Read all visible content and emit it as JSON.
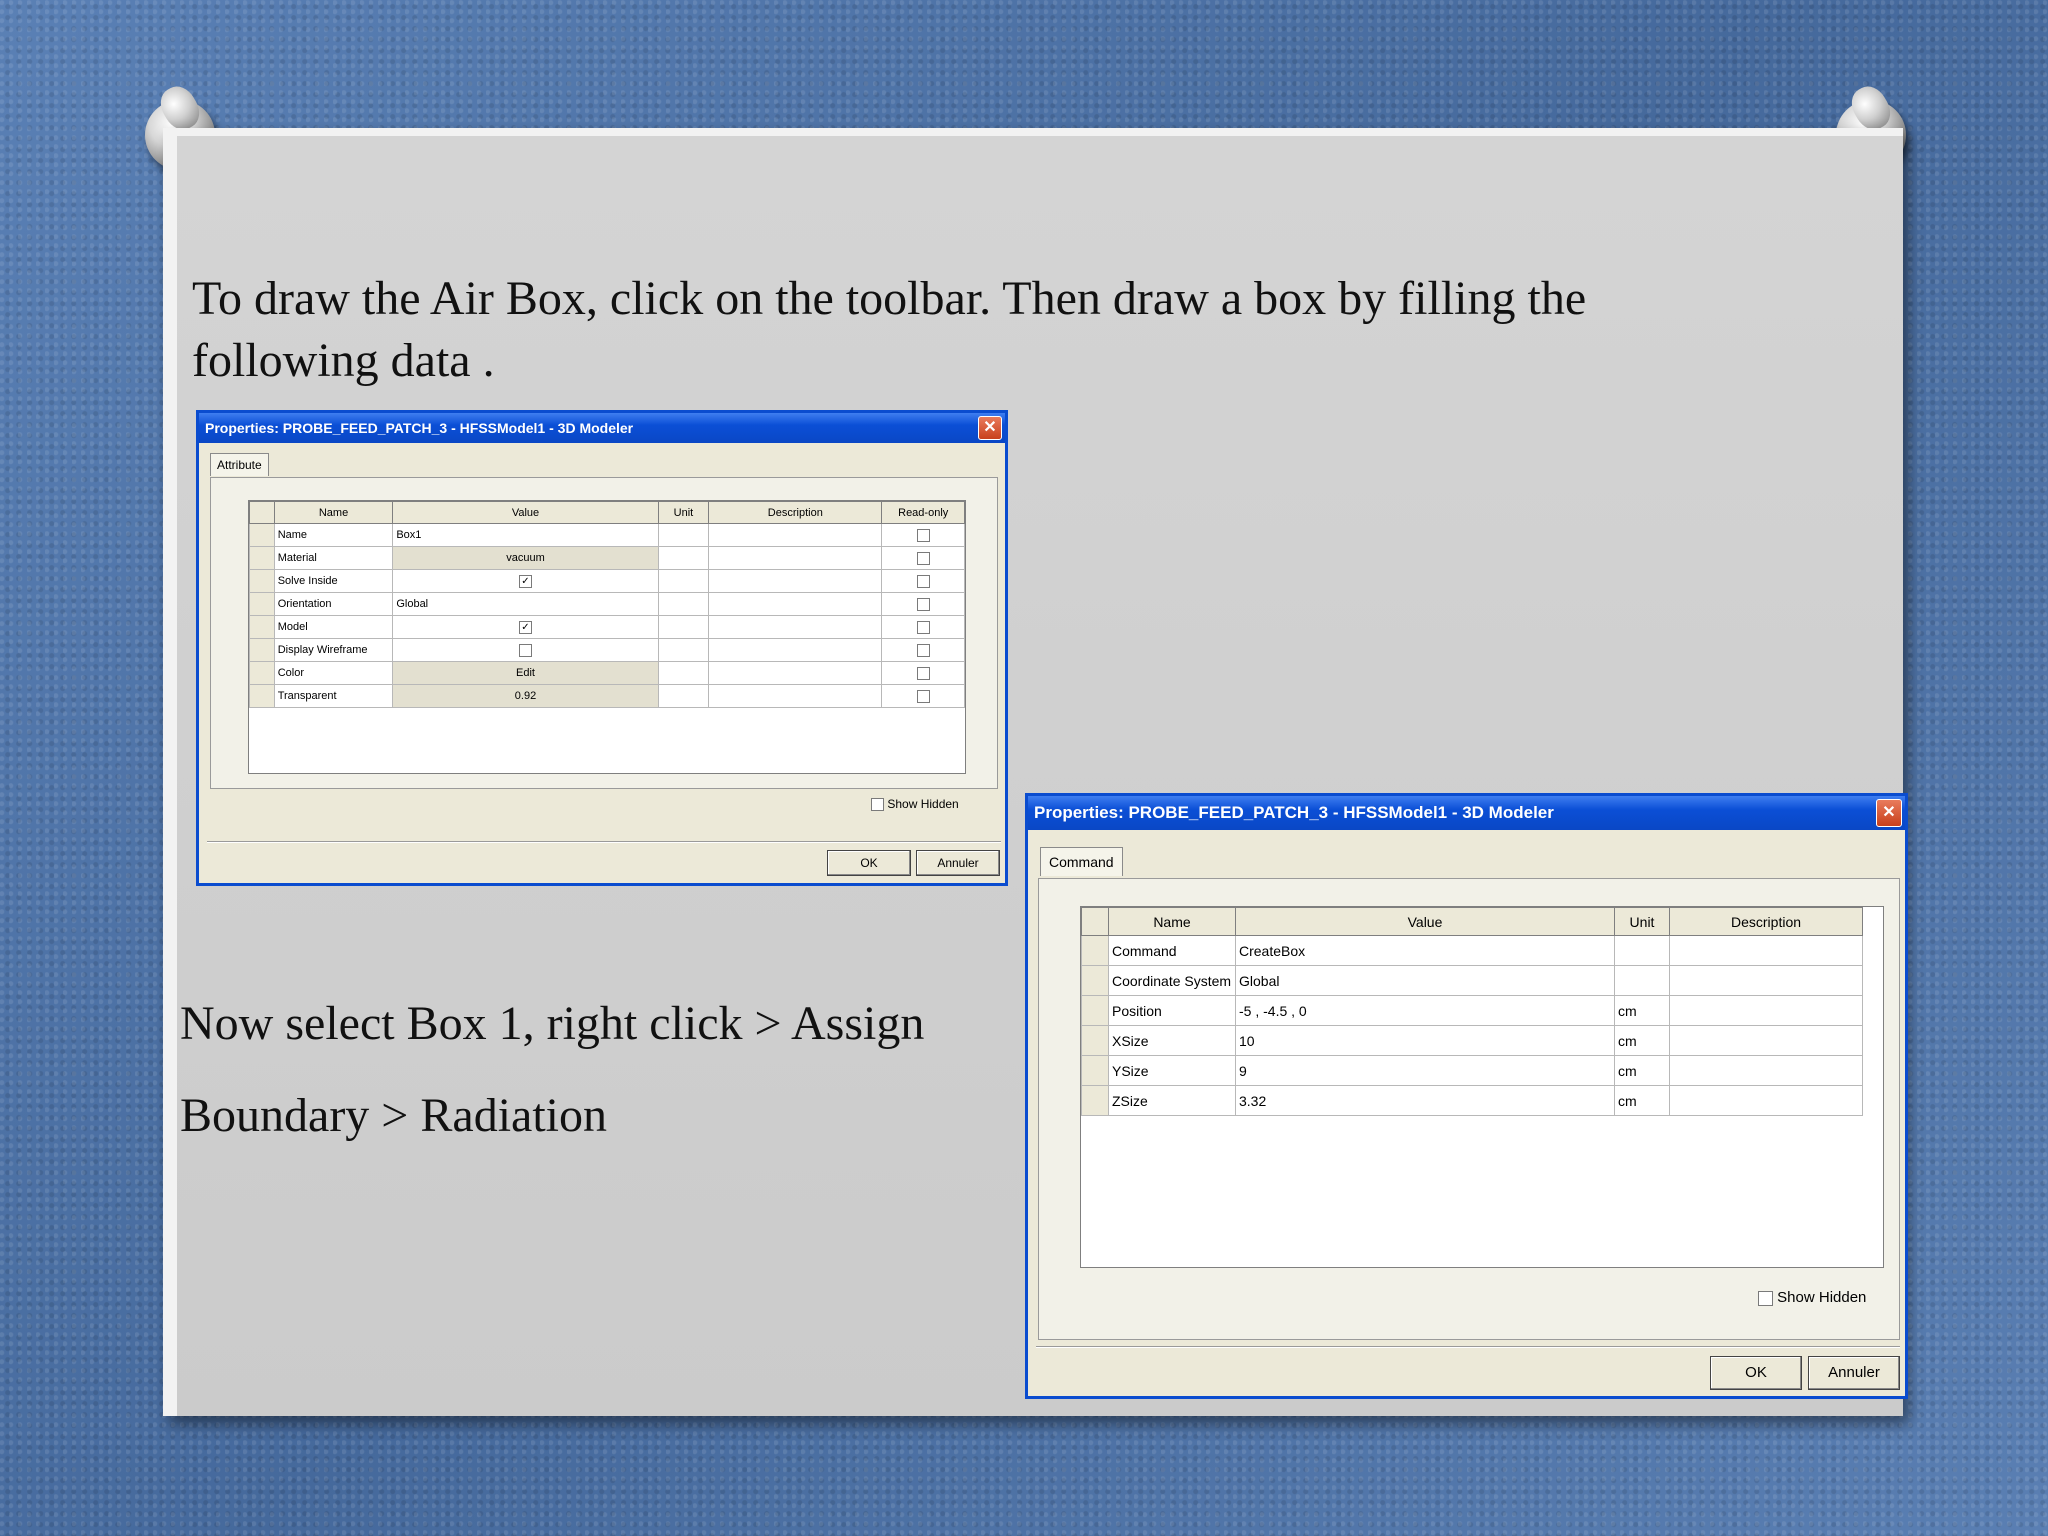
{
  "slide": {
    "paragraph1": "To draw the Air Box, click on the toolbar. Then draw a box by filling the following data .",
    "paragraph2": "Now select Box 1, right click > Assign Boundary > Radiation"
  },
  "dialog1": {
    "title": "Properties: PROBE_FEED_PATCH_3 - HFSSModel1 - 3D Modeler",
    "close_glyph": "✕",
    "tab": "Attribute",
    "columns": [
      "Name",
      "Value",
      "Unit",
      "Description",
      "Read-only"
    ],
    "rows": [
      {
        "name": "Name",
        "value": "Box1"
      },
      {
        "name": "Material",
        "value": "vacuum"
      },
      {
        "name": "Solve Inside",
        "value": "✓"
      },
      {
        "name": "Orientation",
        "value": "Global"
      },
      {
        "name": "Model",
        "value": "✓"
      },
      {
        "name": "Display Wireframe",
        "value": ""
      },
      {
        "name": "Color",
        "value": "Edit"
      },
      {
        "name": "Transparent",
        "value": "0.92"
      }
    ],
    "show_hidden": "Show Hidden",
    "ok": "OK",
    "cancel": "Annuler"
  },
  "dialog2": {
    "title": "Properties: PROBE_FEED_PATCH_3 - HFSSModel1 - 3D Modeler",
    "close_glyph": "✕",
    "tab": "Command",
    "columns": [
      "Name",
      "Value",
      "Unit",
      "Description"
    ],
    "rows": [
      {
        "name": "Command",
        "value": "CreateBox",
        "unit": ""
      },
      {
        "name": "Coordinate System",
        "value": "Global",
        "unit": ""
      },
      {
        "name": "Position",
        "value": "-5 , -4.5 , 0",
        "unit": "cm"
      },
      {
        "name": "XSize",
        "value": "10",
        "unit": "cm"
      },
      {
        "name": "YSize",
        "value": "9",
        "unit": "cm"
      },
      {
        "name": "ZSize",
        "value": "3.32",
        "unit": "cm"
      }
    ],
    "show_hidden": "Show Hidden",
    "ok": "OK",
    "cancel": "Annuler"
  },
  "colors": {
    "background": "#4e74a8",
    "slide": "#cfcfcf",
    "titlebar": "#0b4fd6",
    "dialog": "#ece9d8"
  }
}
